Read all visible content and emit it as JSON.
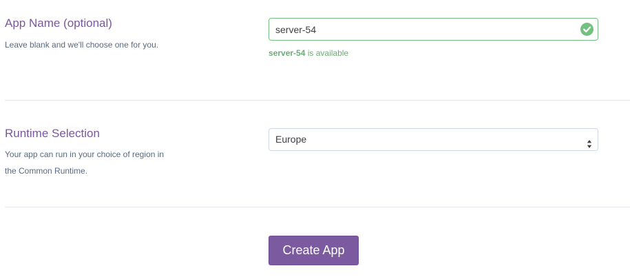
{
  "app_name": {
    "title": "App Name (optional)",
    "description": "Leave blank and we'll choose one for you.",
    "input_value": "server-54",
    "availability_name": "server-54",
    "availability_suffix": " is available",
    "status_icon": "check-circle-icon",
    "status_color": "#74c080"
  },
  "runtime": {
    "title": "Runtime Selection",
    "description_line1": "Your app can run in your choice of region in",
    "description_line2": "the Common Runtime.",
    "selected_region": "Europe",
    "select_icon": "up-down-arrows-icon"
  },
  "actions": {
    "create_label": "Create App",
    "button_color": "#7c5aa0"
  }
}
